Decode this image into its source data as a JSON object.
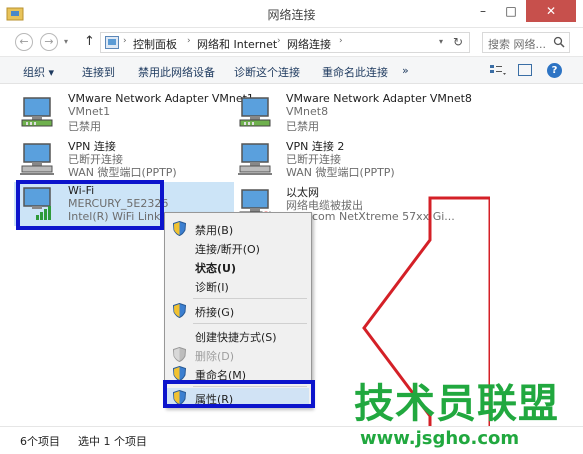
{
  "window": {
    "title": "网络连接",
    "minimize": "–",
    "maximize": "□",
    "close": "✕"
  },
  "nav": {
    "back": "←",
    "forward": "→",
    "history": "▾",
    "up": "↑",
    "breadcrumb": [
      "控制面板",
      "网络和 Internet",
      "网络连接"
    ],
    "search_placeholder": "搜索 网络..."
  },
  "commands": {
    "organize": "组织 ▾",
    "connect_to": "连接到",
    "disable_device": "禁用此网络设备",
    "diagnose": "诊断这个连接",
    "rename": "重命名此连接",
    "more": "»",
    "view": "view-options-icon",
    "pane": "preview-pane-icon",
    "help": "?"
  },
  "connections": [
    {
      "name": "VMware Network Adapter VMnet1",
      "line2": "VMnet1",
      "line3": "已禁用",
      "icon": "network-adapter-icon"
    },
    {
      "name": "VMware Network Adapter VMnet8",
      "line2": "VMnet8",
      "line3": "已禁用",
      "icon": "network-adapter-icon"
    },
    {
      "name": "VPN 连接",
      "line2": "已断开连接",
      "line3": "WAN 微型端口(PPTP)",
      "icon": "vpn-adapter-icon"
    },
    {
      "name": "VPN 连接 2",
      "line2": "已断开连接",
      "line3": "WAN 微型端口(PPTP)",
      "icon": "vpn-adapter-icon"
    },
    {
      "name": "Wi-Fi",
      "line2": "MERCURY_5E2326",
      "line3": "Intel(R) WiFi Link 5",
      "icon": "wifi-adapter-icon"
    },
    {
      "name": "以太网",
      "line2": "网络电缆被拔出",
      "line3": "com NetXtreme 57xx Gi...",
      "icon": "ethernet-adapter-icon"
    }
  ],
  "context_menu": [
    {
      "label": "禁用(B)",
      "shield": true,
      "bold": false,
      "disabled": false
    },
    {
      "label": "连接/断开(O)",
      "shield": false,
      "bold": false,
      "disabled": false
    },
    {
      "label": "状态(U)",
      "shield": false,
      "bold": true,
      "disabled": false
    },
    {
      "label": "诊断(I)",
      "shield": false,
      "bold": false,
      "disabled": false
    },
    {
      "label": "桥接(G)",
      "shield": true,
      "bold": false,
      "disabled": false
    },
    {
      "label": "创建快捷方式(S)",
      "shield": false,
      "bold": false,
      "disabled": false
    },
    {
      "label": "删除(D)",
      "shield": true,
      "bold": false,
      "disabled": true
    },
    {
      "label": "重命名(M)",
      "shield": true,
      "bold": false,
      "disabled": false
    },
    {
      "label": "属性(R)",
      "shield": true,
      "bold": false,
      "disabled": false,
      "highlighted": true
    }
  ],
  "status": {
    "count": "6个项目",
    "selected": "选中 1 个项目"
  },
  "watermark": {
    "text": "技术员联盟",
    "url": "www.jsgho.com"
  },
  "colors": {
    "highlight_box": "#0c14cc",
    "arrow": "#d42027",
    "selection": "#cce4f7",
    "watermark": "#21a83f"
  }
}
